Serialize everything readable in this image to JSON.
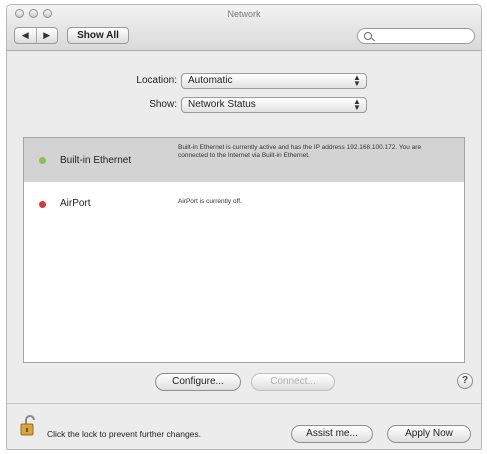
{
  "window": {
    "title": "Network"
  },
  "toolbar": {
    "back_glyph": "◀",
    "forward_glyph": "▶",
    "show_all_label": "Show All",
    "search_placeholder": ""
  },
  "location": {
    "label": "Location:",
    "value": "Automatic"
  },
  "show": {
    "label": "Show:",
    "value": "Network Status"
  },
  "services": [
    {
      "name": "Built-in Ethernet",
      "status_color": "#8cc04a",
      "description": "Built-in Ethernet is currently active and has the IP address 192.168.100.172. You are connected to the Internet via Built-in Ethernet."
    },
    {
      "name": "AirPort",
      "status_color": "#d23a3a",
      "description": "AirPort is currently off."
    }
  ],
  "buttons": {
    "configure": "Configure...",
    "connect": "Connect...",
    "help": "?",
    "assist": "Assist me...",
    "apply": "Apply Now"
  },
  "lock": {
    "message": "Click the lock to prevent further changes."
  },
  "colors": {
    "selection": "#d3d3d3",
    "window_bg": "#ececec"
  }
}
